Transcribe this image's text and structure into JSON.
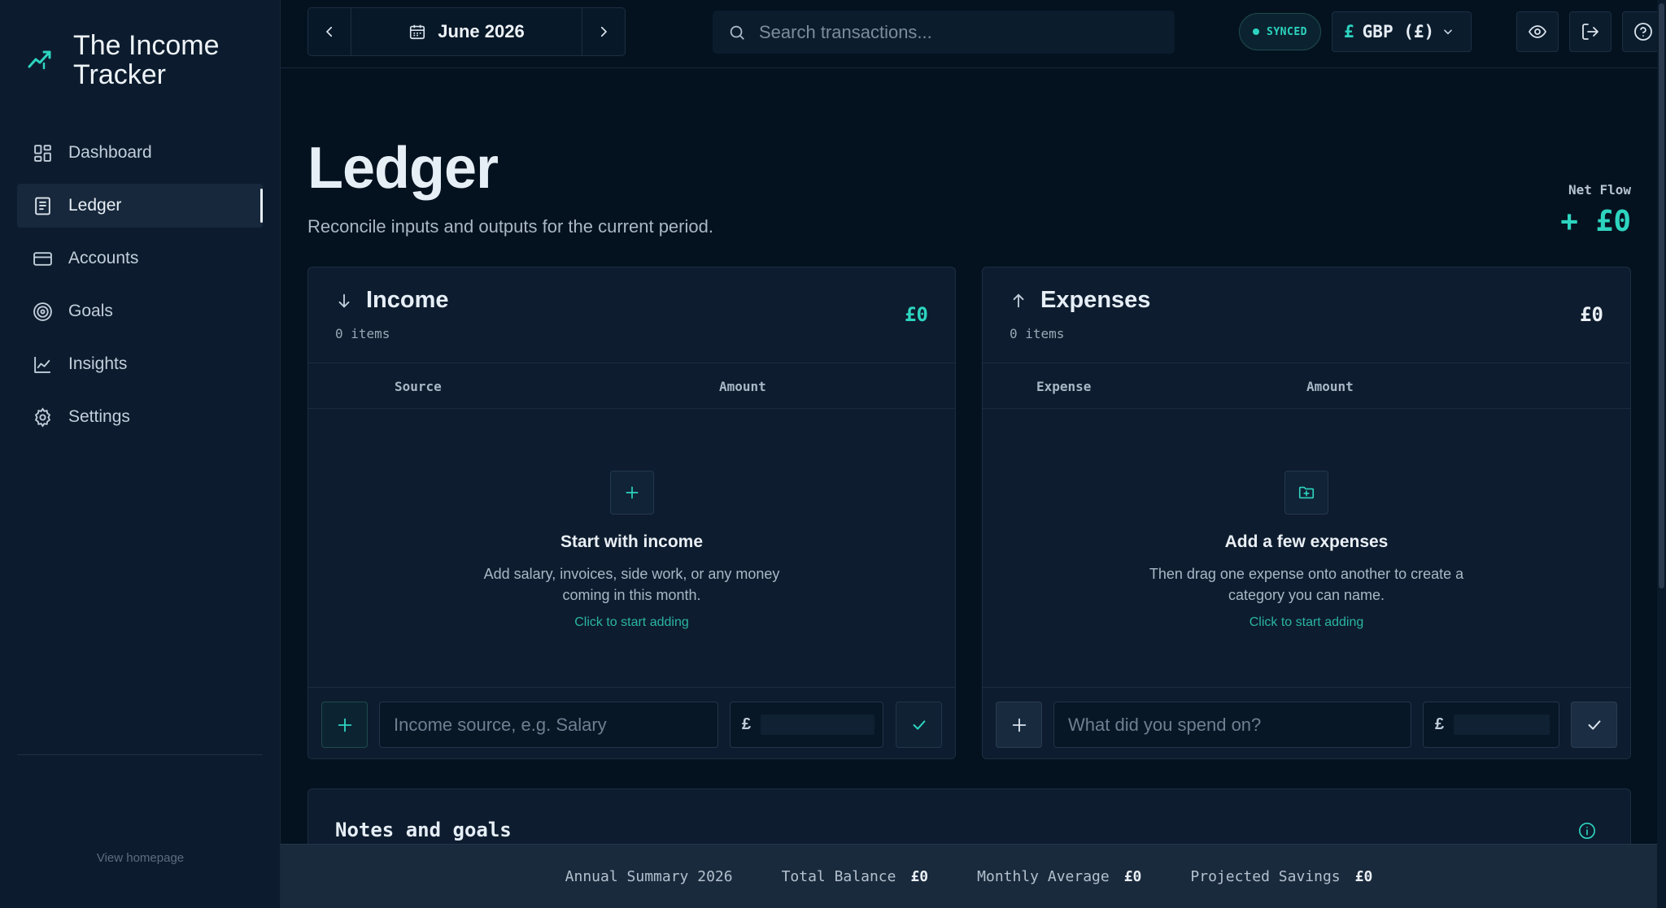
{
  "brand": {
    "title": "The Income Tracker"
  },
  "sidebar": {
    "items": [
      {
        "label": "Dashboard",
        "icon": "dashboard-icon"
      },
      {
        "label": "Ledger",
        "icon": "ledger-icon",
        "active": true
      },
      {
        "label": "Accounts",
        "icon": "card-icon"
      },
      {
        "label": "Goals",
        "icon": "target-icon"
      },
      {
        "label": "Insights",
        "icon": "chart-icon"
      },
      {
        "label": "Settings",
        "icon": "gear-icon"
      }
    ],
    "footer_link": "View homepage"
  },
  "topbar": {
    "month": "June 2026",
    "search_placeholder": "Search transactions...",
    "sync_status": "SYNCED",
    "currency_symbol": "£",
    "currency_label": "GBP (£)"
  },
  "page": {
    "title": "Ledger",
    "subtitle": "Reconcile inputs and outputs for the current period.",
    "net_flow_label": "Net Flow",
    "net_flow_value": "+ £0"
  },
  "income": {
    "title": "Income",
    "count": "0 items",
    "total": "£0",
    "col_source": "Source",
    "col_amount": "Amount",
    "empty_title": "Start with income",
    "empty_text": "Add salary, invoices, side work, or any money coming in this month.",
    "empty_link": "Click to start adding",
    "input_placeholder": "Income source, e.g. Salary",
    "amount_symbol": "£"
  },
  "expenses": {
    "title": "Expenses",
    "count": "0 items",
    "total": "£0",
    "col_expense": "Expense",
    "col_amount": "Amount",
    "empty_title": "Add a few expenses",
    "empty_text": "Then drag one expense onto another to create a category you can name.",
    "empty_link": "Click to start adding",
    "input_placeholder": "What did you spend on?",
    "amount_symbol": "£"
  },
  "notes": {
    "title": "Notes and goals"
  },
  "summary": {
    "year_label": "Annual Summary 2026",
    "total_balance_label": "Total Balance",
    "total_balance_value": "£0",
    "monthly_avg_label": "Monthly Average",
    "monthly_avg_value": "£0",
    "projected_label": "Projected Savings",
    "projected_value": "£0"
  },
  "colors": {
    "accent": "#2dd4bf",
    "background": "#04121f",
    "panel": "#0d1c2e"
  }
}
